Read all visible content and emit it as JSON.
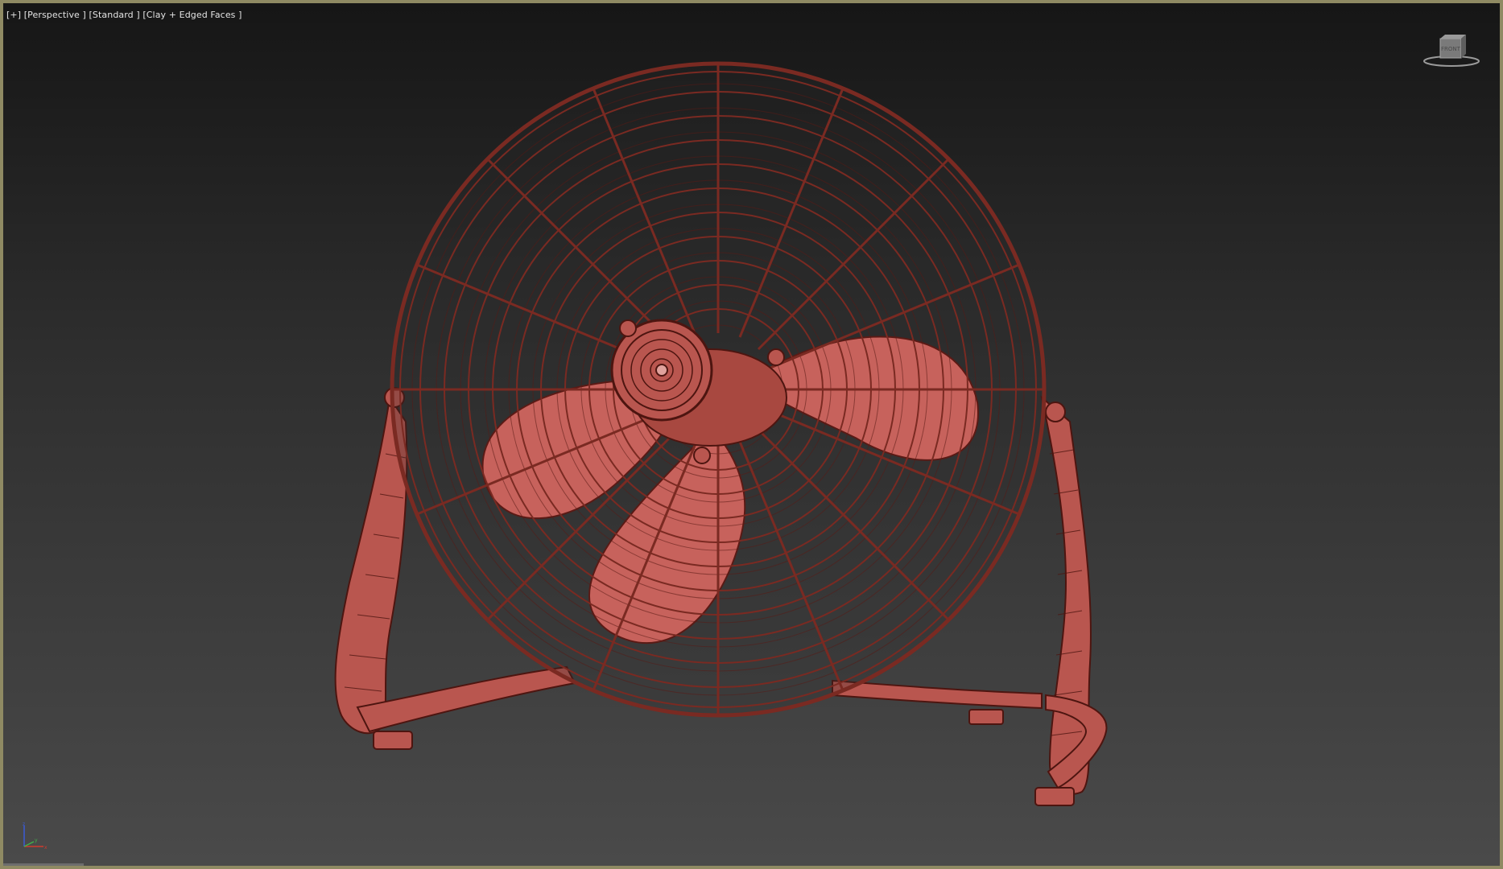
{
  "viewport": {
    "label_plus": "[+]",
    "label_view": "[Perspective ]",
    "label_shading": "[Standard ]",
    "label_style": "[Clay + Edged Faces ]"
  },
  "viewcube": {
    "face_label": "FRONT",
    "icon": "viewcube-icon"
  },
  "axis": {
    "x": "x",
    "y": "y",
    "z": "z",
    "icon": "axis-tripod-icon"
  },
  "colors": {
    "frame_border": "#8f8a63",
    "model_fill": "#c7625c",
    "model_wire": "#5a1a15",
    "bg_top": "#161616",
    "bg_bottom": "#4a4a4a"
  }
}
